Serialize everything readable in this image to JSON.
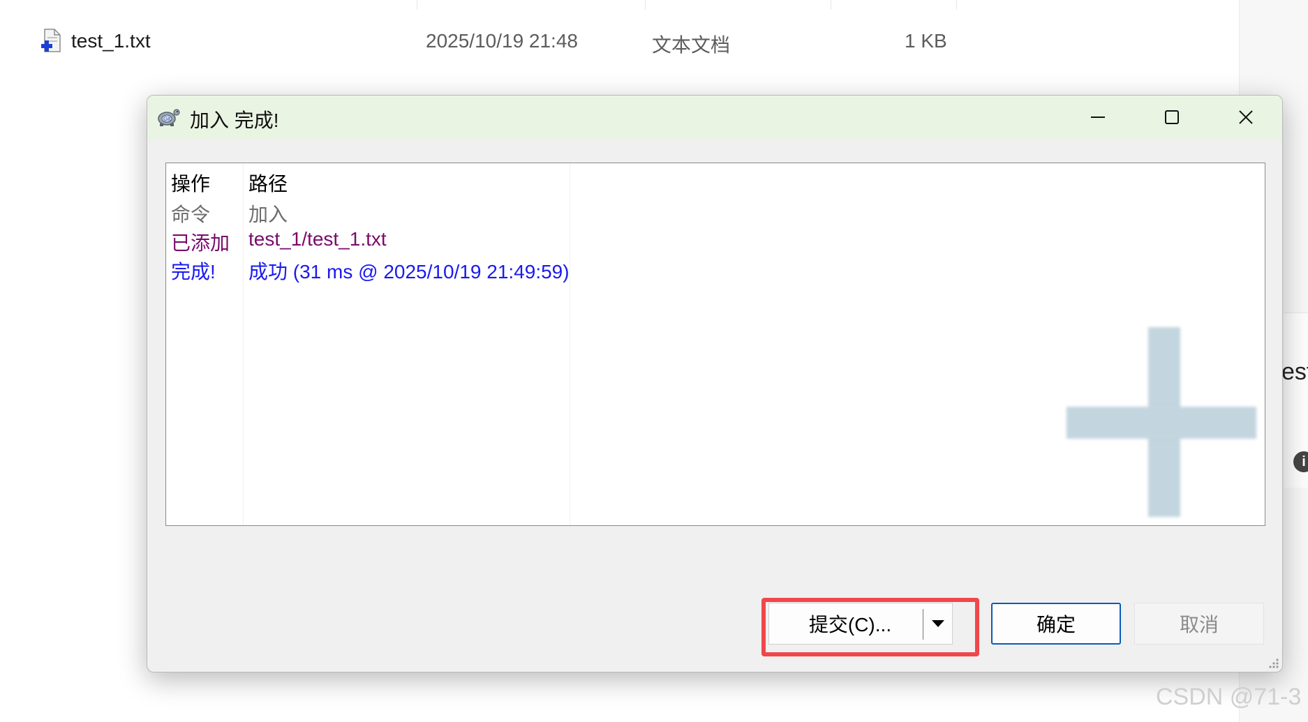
{
  "explorer": {
    "file": {
      "name": "test_1.txt",
      "modified": "2025/10/19 21:48",
      "type": "文本文档",
      "size": "1 KB"
    },
    "right_panel_text": "est",
    "info_icon": "i"
  },
  "dialog": {
    "title": "加入 完成!",
    "window_controls": [
      "minimize-icon",
      "maximize-icon",
      "close-icon"
    ],
    "log": {
      "headers": {
        "action": "操作",
        "path": "路径"
      },
      "rows": [
        {
          "action": "命令",
          "path": "加入",
          "color": "#6d6d6d"
        },
        {
          "action": "已添加",
          "path": "test_1/test_1.txt",
          "color": "#7a0a6b"
        },
        {
          "action": "完成!",
          "path": "成功 (31 ms @ 2025/10/19 21:49:59)",
          "color": "#1a1aee"
        }
      ]
    },
    "buttons": {
      "commit": "提交(C)...",
      "ok": "确定",
      "cancel": "取消"
    },
    "highlight_color": "#f0474b"
  },
  "watermark": "CSDN @71-3"
}
